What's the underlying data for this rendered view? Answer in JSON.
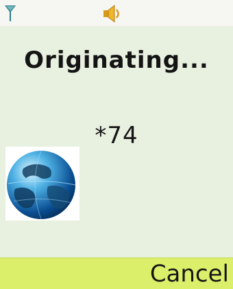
{
  "status_bar": {
    "signal_icon": "signal-antenna-icon",
    "speaker_icon": "speaker-icon"
  },
  "call": {
    "status": "Originating...",
    "number": "*74",
    "globe_icon": "globe-icon"
  },
  "softkeys": {
    "right_label": "Cancel"
  },
  "colors": {
    "content_bg": "#e8f0df",
    "softkey_bg": "#dcef6a",
    "status_bar_bg": "#f6f6f2"
  }
}
